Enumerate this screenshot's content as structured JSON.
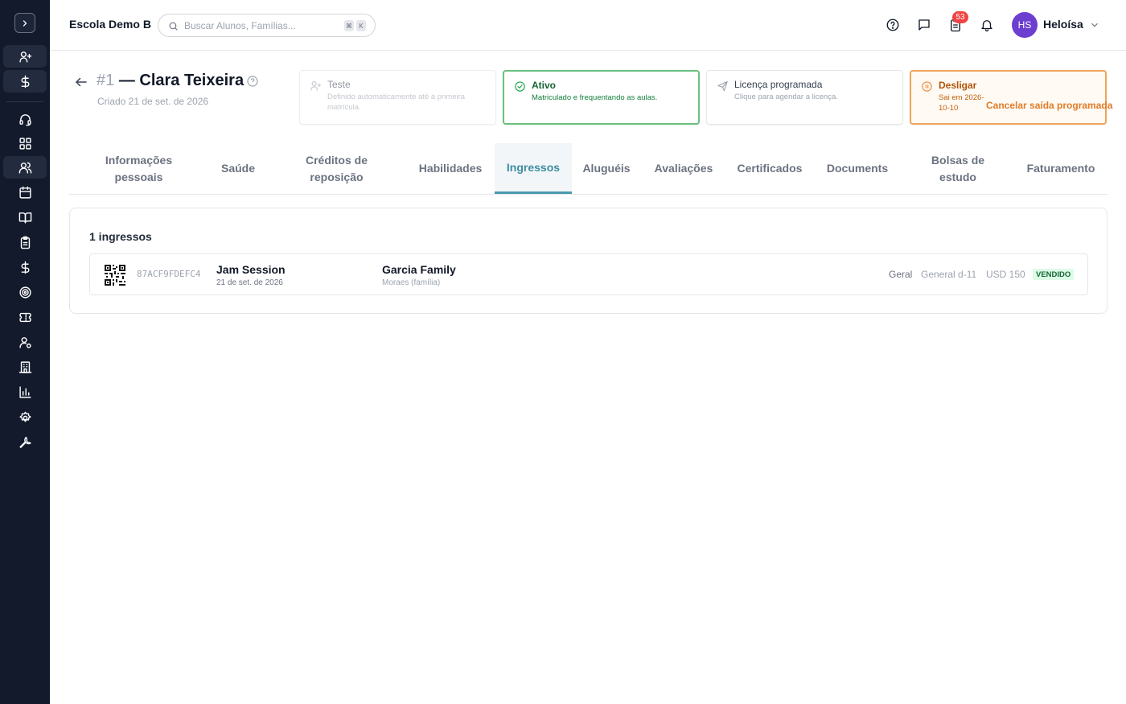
{
  "app": {
    "school_name": "Escola Demo B"
  },
  "search": {
    "placeholder": "Buscar Alunos, Famílias...",
    "kbd_1": "⌘",
    "kbd_2": "K"
  },
  "header_actions": {
    "tasks_badge": "53",
    "avatar_initials": "HS",
    "user_name": "Heloísa"
  },
  "sidebar": {
    "items": [
      {
        "name": "user-plus-icon"
      },
      {
        "name": "dollar-icon"
      },
      {
        "name": "headset-icon"
      },
      {
        "name": "grid-icon"
      },
      {
        "name": "users-icon"
      },
      {
        "name": "calendar-icon"
      },
      {
        "name": "book-icon"
      },
      {
        "name": "clipboard-icon"
      },
      {
        "name": "dollar-icon"
      },
      {
        "name": "target-icon"
      },
      {
        "name": "ticket-icon"
      },
      {
        "name": "user-gear-icon"
      },
      {
        "name": "building-icon"
      },
      {
        "name": "chart-icon"
      },
      {
        "name": "gear-icon"
      },
      {
        "name": "wrench-icon"
      }
    ],
    "active_item": "users-icon"
  },
  "student": {
    "number": "#1",
    "name": "— Clara Teixeira",
    "created": "Criado 21 de set. de 2026"
  },
  "status_cards": {
    "teste": {
      "title": "Teste",
      "desc": "Definido automaticamente até a primeira matrícula."
    },
    "ativo": {
      "title": "Ativo",
      "desc": "Matriculado e frequentando as aulas."
    },
    "licenca": {
      "title": "Licença programada",
      "desc": "Clique para agendar a licença."
    },
    "desligar": {
      "title": "Desligar",
      "desc": "Sai em 2026-10-10",
      "action": "Cancelar saída programada"
    }
  },
  "tabs": [
    {
      "label": "Informações pessoais"
    },
    {
      "label": "Saúde"
    },
    {
      "label": "Créditos de reposição"
    },
    {
      "label": "Habilidades"
    },
    {
      "label": "Ingressos"
    },
    {
      "label": "Aluguéis"
    },
    {
      "label": "Avaliações"
    },
    {
      "label": "Certificados"
    },
    {
      "label": "Documents"
    },
    {
      "label": "Bolsas de estudo"
    },
    {
      "label": "Faturamento"
    }
  ],
  "active_tab": "Ingressos",
  "tickets": {
    "count_label": "1 ingressos",
    "rows": [
      {
        "code": "87ACF9FDEFC4",
        "event": "Jam Session",
        "date": "21 de set. de 2026",
        "family": "Garcia Family",
        "family_sub": "Moraes (família)",
        "type": "Geral",
        "ticket_class": "General d-11",
        "price": "USD 150",
        "status": "VENDIDO"
      }
    ]
  },
  "colors": {
    "sidebar": "#131a2c",
    "accent": "#3d8da0",
    "active_green": "#6ac07f",
    "warning_orange": "#f0a45b",
    "badge_red": "#ef4444",
    "avatar": "#6d3fd0"
  }
}
